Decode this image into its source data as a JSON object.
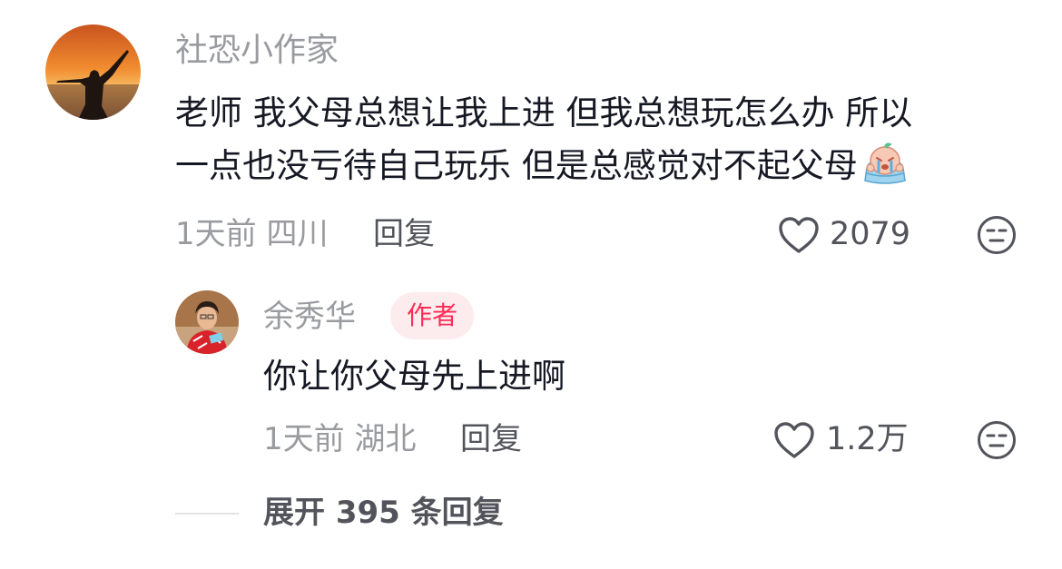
{
  "comment": {
    "username": "社恐小作家",
    "text_line1": "老师 我父母总想让我上进 但我总想玩怎么办 所以",
    "text_line2": "一点也没亏待自己玩乐 但是总感觉对不起父母",
    "emoji_icon": "crying-face-sticker",
    "time": "1天前",
    "location": "四川",
    "reply_label": "回复",
    "likes": "2079"
  },
  "reply": {
    "username": "余秀华",
    "badge": "作者",
    "text": "你让你父母先上进啊",
    "time": "1天前",
    "location": "湖北",
    "reply_label": "回复",
    "likes": "1.2万"
  },
  "expand": {
    "label": "展开 395 条回复"
  },
  "colors": {
    "primary_text": "#161823",
    "secondary_text": "#9a9ba0",
    "author_badge_bg": "#fdecee",
    "author_badge_text": "#fe2c55"
  }
}
